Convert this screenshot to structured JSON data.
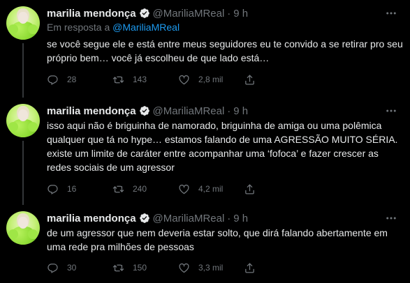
{
  "colors": {
    "background": "#000000",
    "text": "#e7e9ea",
    "muted": "#71767b",
    "accent": "#1d9bf0",
    "divider": "#2f3336"
  },
  "tweets": [
    {
      "name": "marilia mendonça",
      "handle": "@MariliaMReal",
      "time": "9 h",
      "reply_prefix": "Em resposta a",
      "reply_mention": "@MariliaMReal",
      "text": "se você segue ele e está entre meus seguidores eu te convido a se retirar pro seu próprio bem… você já escolheu de que lado está…",
      "replies": "28",
      "retweets": "143",
      "likes": "2,8 mil",
      "icons": [
        "reply-icon",
        "retweet-icon",
        "like-icon",
        "share-icon",
        "verified-icon",
        "more-icon"
      ]
    },
    {
      "name": "marilia mendonça",
      "handle": "@MariliaMReal",
      "time": "9 h",
      "text": "isso aqui não é briguinha de namorado, briguinha de amiga ou uma polêmica qualquer que tá no hype… estamos falando de uma AGRESSÃO MUITO SÉRIA. existe um limite de caráter entre acompanhar uma ‘fofoca’ e fazer crescer as redes sociais de um agressor",
      "replies": "16",
      "retweets": "240",
      "likes": "4,2 mil"
    },
    {
      "name": "marilia mendonça",
      "handle": "@MariliaMReal",
      "time": "9 h",
      "text": "de um agressor que nem deveria estar solto, que dirá falando abertamente em uma rede pra milhões de pessoas",
      "replies": "30",
      "retweets": "150",
      "likes": "3,3 mil"
    }
  ]
}
